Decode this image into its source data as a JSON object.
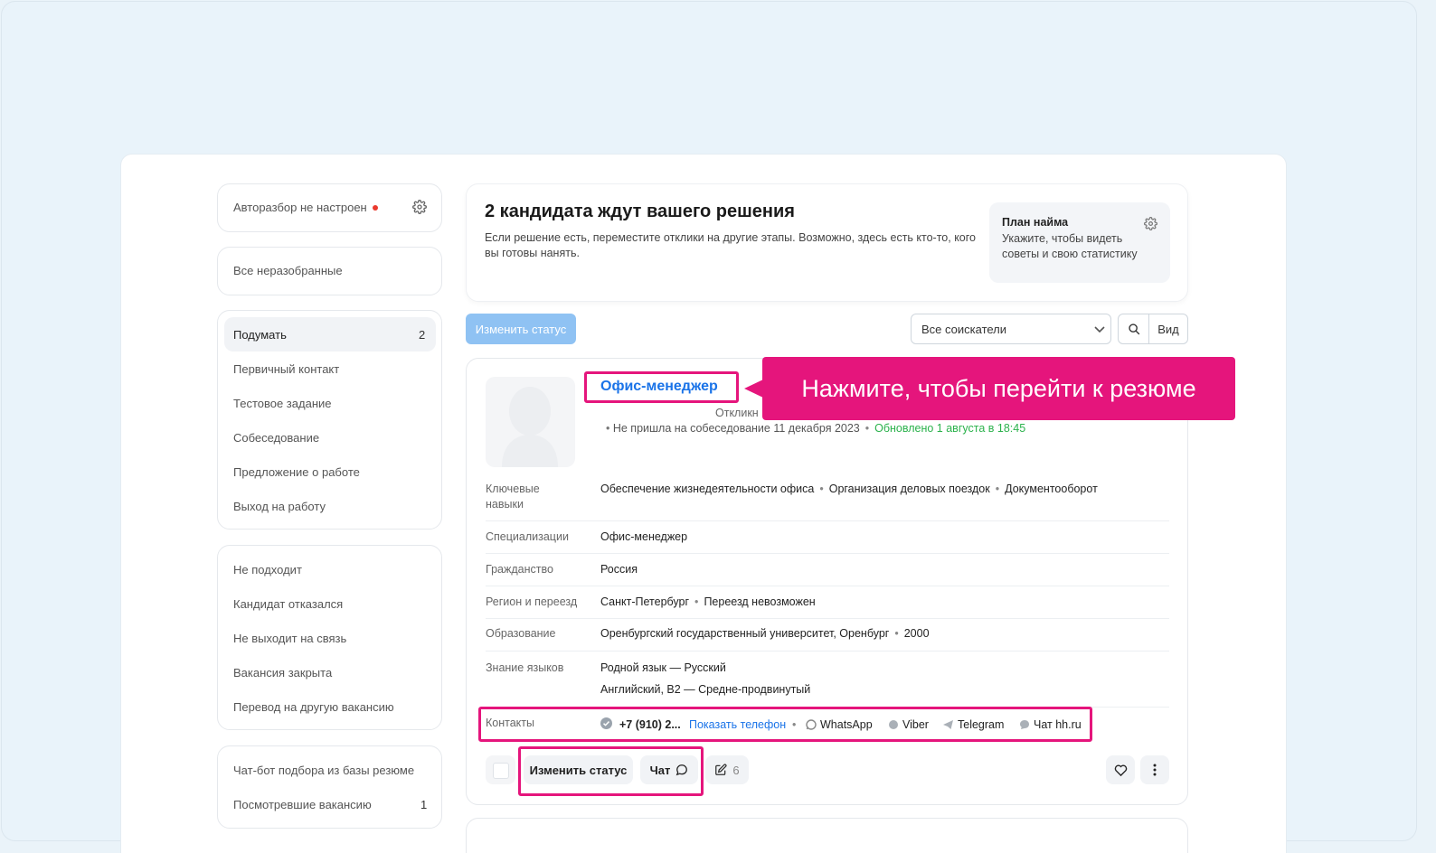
{
  "sidebar": {
    "autosort_label": "Авторазбор не настроен",
    "all_unsorted": "Все неразобранные",
    "stages": [
      {
        "label": "Подумать",
        "count": "2"
      },
      {
        "label": "Первичный контакт"
      },
      {
        "label": "Тестовое задание"
      },
      {
        "label": "Собеседование"
      },
      {
        "label": "Предложение о работе"
      },
      {
        "label": "Выход на работу"
      }
    ],
    "rejected": [
      {
        "label": "Не подходит"
      },
      {
        "label": "Кандидат отказался"
      },
      {
        "label": "Не выходит на связь"
      },
      {
        "label": "Вакансия закрыта"
      },
      {
        "label": "Перевод на другую вакансию"
      }
    ],
    "extra": [
      {
        "label": "Чат-бот подбора из базы резюме"
      },
      {
        "label": "Посмотревшие вакансию",
        "count": "1"
      }
    ]
  },
  "header": {
    "title": "2 кандидата ждут вашего решения",
    "subtitle": "Если решение есть, переместите отклики на другие этапы. Возможно, здесь есть кто-то, кого вы готовы нанять.",
    "plan_title": "План найма",
    "plan_text": "Укажите, чтобы видеть советы и свою статистику"
  },
  "toolbar": {
    "change_status": "Изменить статус",
    "filter_value": "Все соискатели",
    "view_label": "Вид"
  },
  "candidate": {
    "position": "Офис-менеджер",
    "responded_partial": "Откликн",
    "meta_status": "Не пришла на собеседование 11 декабря 2023",
    "meta_updated": "Обновлено 1 августа в 18:45",
    "rows": {
      "skills_label": "Ключевые навыки",
      "skills": [
        "Обеспечение жизнедеятельности офиса",
        "Организация деловых поездок",
        "Документооборот"
      ],
      "spec_label": "Специализации",
      "spec": "Офис-менеджер",
      "citizenship_label": "Гражданство",
      "citizenship": "Россия",
      "region_label": "Регион и переезд",
      "region": "Санкт-Петербург",
      "relocation": "Переезд невозможен",
      "education_label": "Образование",
      "education": "Оренбургский государственный университет, Оренбург",
      "education_year": "2000",
      "languages_label": "Знание языков",
      "language_1": "Родной язык — Русский",
      "language_2": "Английский, B2 — Средне-продвинутый",
      "contacts_label": "Контакты",
      "phone": "+7 (910) 2...",
      "show_phone": "Показать телефон",
      "whatsapp": "WhatsApp",
      "viber": "Viber",
      "telegram": "Telegram",
      "hh_chat": "Чат hh.ru"
    },
    "actions": {
      "change_status": "Изменить статус",
      "chat": "Чат",
      "notes_count": "6"
    }
  },
  "tooltip": {
    "text": "Нажмите, чтобы перейти к резюме"
  },
  "colors": {
    "accent_pink": "#e5157c",
    "link_blue": "#1a73e8",
    "updated_green": "#2bb24c",
    "button_blue_disabled": "#8fc2f3"
  }
}
